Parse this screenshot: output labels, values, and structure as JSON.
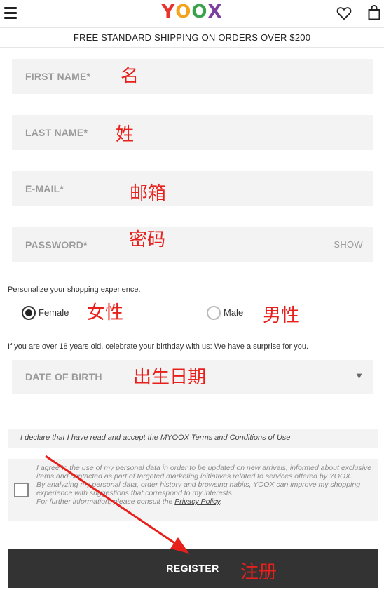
{
  "header": {
    "logo_text": "YOOX",
    "logo_colors": [
      "#e8322b",
      "#f4a21c",
      "#3aa14d",
      "#7b3fa0"
    ],
    "icons": [
      "menu-icon",
      "heart-icon",
      "bag-icon"
    ]
  },
  "shipping_banner": "FREE STANDARD SHIPPING ON ORDERS OVER $200",
  "form": {
    "first_name_label": "FIRST NAME*",
    "last_name_label": "LAST NAME*",
    "email_label": "E-MAIL*",
    "password_label": "PASSWORD*",
    "password_show": "SHOW",
    "personalize_text": "Personalize your shopping experience.",
    "gender": {
      "female_label": "Female",
      "male_label": "Male",
      "selected": "Female"
    },
    "birthday_text": "If you are over 18 years old, celebrate your birthday with us: We have a surprise for you.",
    "dob_label": "DATE OF BIRTH",
    "dob_arrow": "▼",
    "terms_prefix": "I declare that I have read and accept the ",
    "terms_link": "MYOOX Terms and Conditions of Use",
    "privacy_line1": "I agree to the use of my personal data in order to be updated on new arrivals, informed about exclusive items and contacted as part of targeted marketing initiatives related to services offered by YOOX.",
    "privacy_line2": "By analyzing my personal data, order history and browsing habits, YOOX can improve my shopping experience with suggestions that correspond to my interests.",
    "privacy_line3_prefix": "For further information, please consult the ",
    "privacy_link": "Privacy Policy",
    "privacy_line3_suffix": ".",
    "register_label": "REGISTER"
  },
  "annotations": {
    "first_name": "名",
    "last_name": "姓",
    "email": "邮箱",
    "password": "密码",
    "female": "女性",
    "male": "男性",
    "dob": "出生日期",
    "register": "注册",
    "color": "#e8201c"
  }
}
